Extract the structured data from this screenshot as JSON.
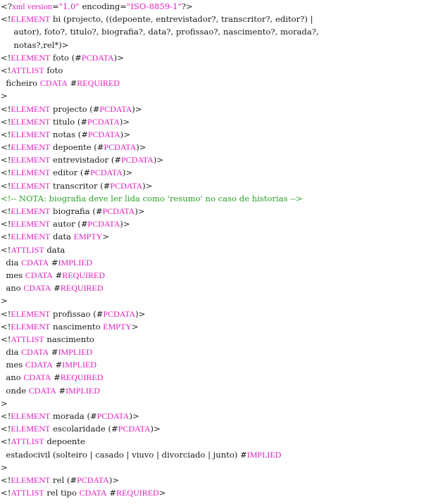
{
  "colors": {
    "keyword": "#e020c0",
    "comment": "#2aa12a",
    "text": "#1a1a1a",
    "background": "#ffffff"
  },
  "lines": [
    [
      {
        "c": "txt",
        "t": "<?"
      },
      {
        "c": "kw",
        "t": "xml version"
      },
      {
        "c": "txt",
        "t": "="
      },
      {
        "c": "str",
        "t": "\"1.0\""
      },
      {
        "c": "txt",
        "t": " encoding="
      },
      {
        "c": "str",
        "t": "\"ISO-8859-1\""
      },
      {
        "c": "txt",
        "t": "?>"
      }
    ],
    [
      {
        "c": "txt",
        "t": "<!"
      },
      {
        "c": "kw",
        "t": "ELEMENT"
      },
      {
        "c": "txt",
        "t": " bi (projecto, ((depoente, entrevistador?, transcritor?, editor?) |"
      }
    ],
    [
      {
        "c": "txt",
        "t": "     autor), foto?, titulo?, biografia?, data?, profissao?, nascimento?, morada?,"
      }
    ],
    [
      {
        "c": "txt",
        "t": "     notas?,rel*)>"
      }
    ],
    [
      {
        "c": "txt",
        "t": "<!"
      },
      {
        "c": "kw",
        "t": "ELEMENT"
      },
      {
        "c": "txt",
        "t": " foto (#"
      },
      {
        "c": "kw",
        "t": "PCDATA"
      },
      {
        "c": "txt",
        "t": ")>"
      }
    ],
    [
      {
        "c": "txt",
        "t": "<!"
      },
      {
        "c": "kw",
        "t": "ATTLIST"
      },
      {
        "c": "txt",
        "t": " foto"
      }
    ],
    [
      {
        "c": "txt",
        "t": "  ficheiro "
      },
      {
        "c": "kw",
        "t": "CDATA"
      },
      {
        "c": "txt",
        "t": " #"
      },
      {
        "c": "kw",
        "t": "REQUIRED"
      }
    ],
    [
      {
        "c": "txt",
        "t": ">"
      }
    ],
    [
      {
        "c": "txt",
        "t": "<!"
      },
      {
        "c": "kw",
        "t": "ELEMENT"
      },
      {
        "c": "txt",
        "t": " projecto (#"
      },
      {
        "c": "kw",
        "t": "PCDATA"
      },
      {
        "c": "txt",
        "t": ")>"
      }
    ],
    [
      {
        "c": "txt",
        "t": "<!"
      },
      {
        "c": "kw",
        "t": "ELEMENT"
      },
      {
        "c": "txt",
        "t": " titulo (#"
      },
      {
        "c": "kw",
        "t": "PCDATA"
      },
      {
        "c": "txt",
        "t": ")>"
      }
    ],
    [
      {
        "c": "txt",
        "t": "<!"
      },
      {
        "c": "kw",
        "t": "ELEMENT"
      },
      {
        "c": "txt",
        "t": " notas (#"
      },
      {
        "c": "kw",
        "t": "PCDATA"
      },
      {
        "c": "txt",
        "t": ")>"
      }
    ],
    [
      {
        "c": "txt",
        "t": "<!"
      },
      {
        "c": "kw",
        "t": "ELEMENT"
      },
      {
        "c": "txt",
        "t": " depoente (#"
      },
      {
        "c": "kw",
        "t": "PCDATA"
      },
      {
        "c": "txt",
        "t": ")>"
      }
    ],
    [
      {
        "c": "txt",
        "t": "<!"
      },
      {
        "c": "kw",
        "t": "ELEMENT"
      },
      {
        "c": "txt",
        "t": " entrevistador (#"
      },
      {
        "c": "kw",
        "t": "PCDATA"
      },
      {
        "c": "txt",
        "t": ")>"
      }
    ],
    [
      {
        "c": "txt",
        "t": "<!"
      },
      {
        "c": "kw",
        "t": "ELEMENT"
      },
      {
        "c": "txt",
        "t": " editor (#"
      },
      {
        "c": "kw",
        "t": "PCDATA"
      },
      {
        "c": "txt",
        "t": ")>"
      }
    ],
    [
      {
        "c": "txt",
        "t": "<!"
      },
      {
        "c": "kw",
        "t": "ELEMENT"
      },
      {
        "c": "txt",
        "t": " transcritor (#"
      },
      {
        "c": "kw",
        "t": "PCDATA"
      },
      {
        "c": "txt",
        "t": ")>"
      }
    ],
    [
      {
        "c": "cmt",
        "t": "<!-- NOTA: biografia deve ler lida como 'resumo' no caso de historias -->"
      }
    ],
    [
      {
        "c": "txt",
        "t": "<!"
      },
      {
        "c": "kw",
        "t": "ELEMENT"
      },
      {
        "c": "txt",
        "t": " biografia (#"
      },
      {
        "c": "kw",
        "t": "PCDATA"
      },
      {
        "c": "txt",
        "t": ")>"
      }
    ],
    [
      {
        "c": "txt",
        "t": "<!"
      },
      {
        "c": "kw",
        "t": "ELEMENT"
      },
      {
        "c": "txt",
        "t": " autor (#"
      },
      {
        "c": "kw",
        "t": "PCDATA"
      },
      {
        "c": "txt",
        "t": ")>"
      }
    ],
    [
      {
        "c": "txt",
        "t": "<!"
      },
      {
        "c": "kw",
        "t": "ELEMENT"
      },
      {
        "c": "txt",
        "t": " data "
      },
      {
        "c": "kw",
        "t": "EMPTY"
      },
      {
        "c": "txt",
        "t": ">"
      }
    ],
    [
      {
        "c": "txt",
        "t": "<!"
      },
      {
        "c": "kw",
        "t": "ATTLIST"
      },
      {
        "c": "txt",
        "t": " data"
      }
    ],
    [
      {
        "c": "txt",
        "t": "  dia "
      },
      {
        "c": "kw",
        "t": "CDATA"
      },
      {
        "c": "txt",
        "t": " #"
      },
      {
        "c": "kw",
        "t": "IMPLIED"
      }
    ],
    [
      {
        "c": "txt",
        "t": "  mes "
      },
      {
        "c": "kw",
        "t": "CDATA"
      },
      {
        "c": "txt",
        "t": " #"
      },
      {
        "c": "kw",
        "t": "REQUIRED"
      }
    ],
    [
      {
        "c": "txt",
        "t": "  ano "
      },
      {
        "c": "kw",
        "t": "CDATA"
      },
      {
        "c": "txt",
        "t": " #"
      },
      {
        "c": "kw",
        "t": "REQUIRED"
      }
    ],
    [
      {
        "c": "txt",
        "t": ">"
      }
    ],
    [
      {
        "c": "txt",
        "t": "<!"
      },
      {
        "c": "kw",
        "t": "ELEMENT"
      },
      {
        "c": "txt",
        "t": " profissao (#"
      },
      {
        "c": "kw",
        "t": "PCDATA"
      },
      {
        "c": "txt",
        "t": ")>"
      }
    ],
    [
      {
        "c": "txt",
        "t": "<!"
      },
      {
        "c": "kw",
        "t": "ELEMENT"
      },
      {
        "c": "txt",
        "t": " nascimento "
      },
      {
        "c": "kw",
        "t": "EMPTY"
      },
      {
        "c": "txt",
        "t": ">"
      }
    ],
    [
      {
        "c": "txt",
        "t": "<!"
      },
      {
        "c": "kw",
        "t": "ATTLIST"
      },
      {
        "c": "txt",
        "t": " nascimento"
      }
    ],
    [
      {
        "c": "txt",
        "t": "  dia "
      },
      {
        "c": "kw",
        "t": "CDATA"
      },
      {
        "c": "txt",
        "t": " #"
      },
      {
        "c": "kw",
        "t": "IMPLIED"
      }
    ],
    [
      {
        "c": "txt",
        "t": "  mes "
      },
      {
        "c": "kw",
        "t": "CDATA"
      },
      {
        "c": "txt",
        "t": " #"
      },
      {
        "c": "kw",
        "t": "IMPLIED"
      }
    ],
    [
      {
        "c": "txt",
        "t": "  ano "
      },
      {
        "c": "kw",
        "t": "CDATA"
      },
      {
        "c": "txt",
        "t": " #"
      },
      {
        "c": "kw",
        "t": "REQUIRED"
      }
    ],
    [
      {
        "c": "txt",
        "t": "  onde "
      },
      {
        "c": "kw",
        "t": "CDATA"
      },
      {
        "c": "txt",
        "t": " #"
      },
      {
        "c": "kw",
        "t": "IMPLIED"
      }
    ],
    [
      {
        "c": "txt",
        "t": ">"
      }
    ],
    [
      {
        "c": "txt",
        "t": "<!"
      },
      {
        "c": "kw",
        "t": "ELEMENT"
      },
      {
        "c": "txt",
        "t": " morada (#"
      },
      {
        "c": "kw",
        "t": "PCDATA"
      },
      {
        "c": "txt",
        "t": ")>"
      }
    ],
    [
      {
        "c": "txt",
        "t": "<!"
      },
      {
        "c": "kw",
        "t": "ELEMENT"
      },
      {
        "c": "txt",
        "t": " escolaridade (#"
      },
      {
        "c": "kw",
        "t": "PCDATA"
      },
      {
        "c": "txt",
        "t": ")>"
      }
    ],
    [
      {
        "c": "txt",
        "t": "<!"
      },
      {
        "c": "kw",
        "t": "ATTLIST"
      },
      {
        "c": "txt",
        "t": " depoente"
      }
    ],
    [
      {
        "c": "txt",
        "t": "  estadocivil (solteiro | casado | viuvo | divorciado | junto) #"
      },
      {
        "c": "kw",
        "t": "IMPLIED"
      }
    ],
    [
      {
        "c": "txt",
        "t": ">"
      }
    ],
    [
      {
        "c": "txt",
        "t": "<!"
      },
      {
        "c": "kw",
        "t": "ELEMENT"
      },
      {
        "c": "txt",
        "t": " rel (#"
      },
      {
        "c": "kw",
        "t": "PCDATA"
      },
      {
        "c": "txt",
        "t": ")>"
      }
    ],
    [
      {
        "c": "txt",
        "t": "<!"
      },
      {
        "c": "kw",
        "t": "ATTLIST"
      },
      {
        "c": "txt",
        "t": " rel tipo "
      },
      {
        "c": "kw",
        "t": "CDATA"
      },
      {
        "c": "txt",
        "t": " #"
      },
      {
        "c": "kw",
        "t": "REQUIRED"
      },
      {
        "c": "txt",
        "t": ">"
      }
    ]
  ]
}
